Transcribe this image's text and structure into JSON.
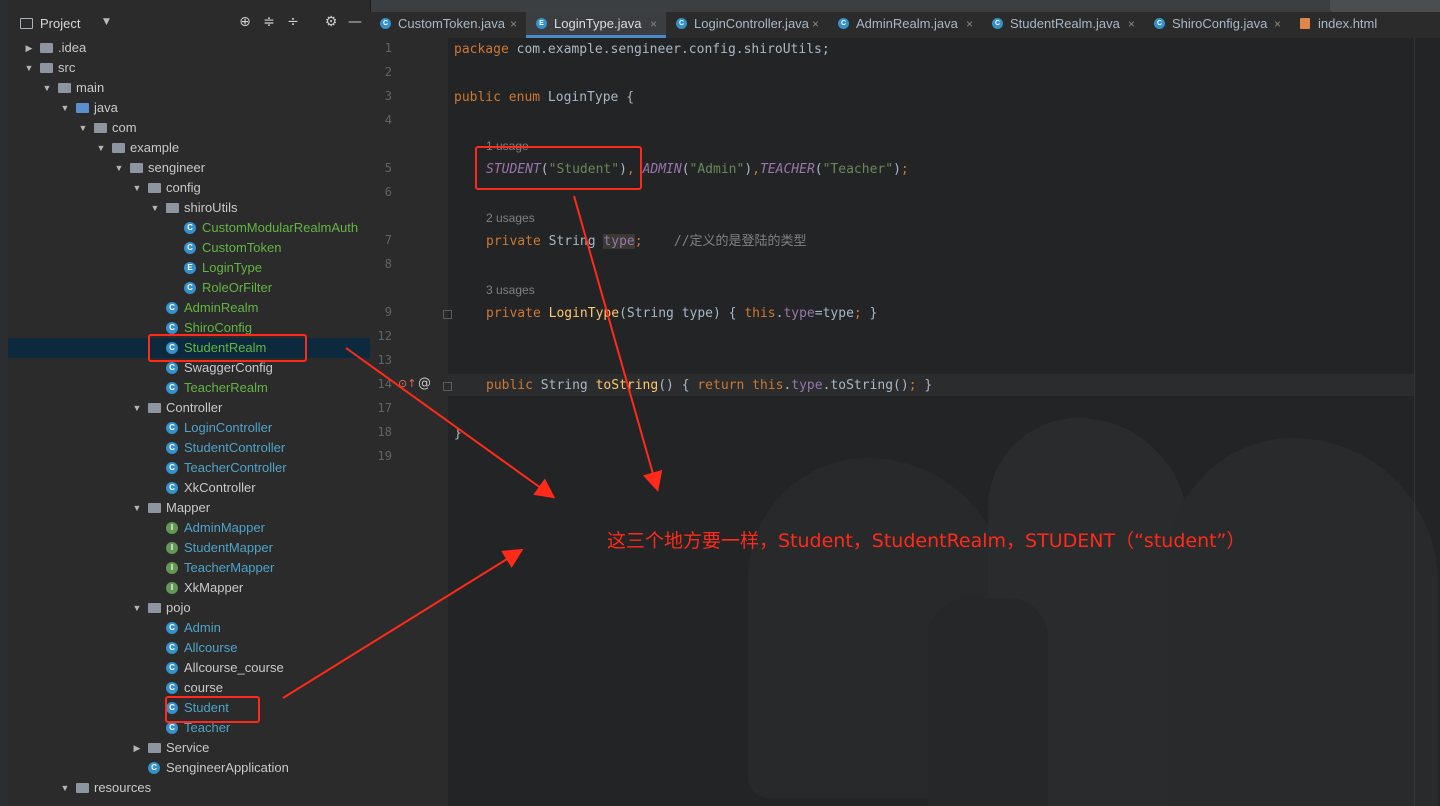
{
  "project_panel": {
    "title": "Project",
    "tree": [
      {
        "label": ".idea",
        "kind": "folder",
        "indent": 1,
        "arrow": "▶"
      },
      {
        "label": "src",
        "kind": "folder",
        "indent": 1,
        "arrow": "▼"
      },
      {
        "label": "main",
        "kind": "folder",
        "indent": 2,
        "arrow": "▼"
      },
      {
        "label": "java",
        "kind": "folder-blue",
        "indent": 3,
        "arrow": "▼"
      },
      {
        "label": "com",
        "kind": "folder",
        "indent": 4,
        "arrow": "▼"
      },
      {
        "label": "example",
        "kind": "folder",
        "indent": 5,
        "arrow": "▼"
      },
      {
        "label": "sengineer",
        "kind": "folder",
        "indent": 6,
        "arrow": "▼"
      },
      {
        "label": "config",
        "kind": "folder",
        "indent": 7,
        "arrow": "▼"
      },
      {
        "label": "shiroUtils",
        "kind": "folder",
        "indent": 8,
        "arrow": "▼"
      },
      {
        "label": "CustomModularRealmAuth",
        "kind": "class",
        "indent": 9,
        "color": "green"
      },
      {
        "label": "CustomToken",
        "kind": "class",
        "indent": 9,
        "color": "green"
      },
      {
        "label": "LoginType",
        "kind": "enum",
        "indent": 9,
        "color": "green"
      },
      {
        "label": "RoleOrFilter",
        "kind": "class",
        "indent": 9,
        "color": "green"
      },
      {
        "label": "AdminRealm",
        "kind": "class",
        "indent": 8,
        "color": "green"
      },
      {
        "label": "ShiroConfig",
        "kind": "class",
        "indent": 8,
        "color": "green"
      },
      {
        "label": "StudentRealm",
        "kind": "class",
        "indent": 8,
        "color": "green",
        "selected": true
      },
      {
        "label": "SwaggerConfig",
        "kind": "class",
        "indent": 8,
        "color": "plain"
      },
      {
        "label": "TeacherRealm",
        "kind": "class",
        "indent": 8,
        "color": "green"
      },
      {
        "label": "Controller",
        "kind": "folder",
        "indent": 7,
        "arrow": "▼"
      },
      {
        "label": "LoginController",
        "kind": "class",
        "indent": 8,
        "color": "teal"
      },
      {
        "label": "StudentController",
        "kind": "class",
        "indent": 8,
        "color": "teal"
      },
      {
        "label": "TeacherController",
        "kind": "class",
        "indent": 8,
        "color": "teal"
      },
      {
        "label": "XkController",
        "kind": "class",
        "indent": 8,
        "color": "plain"
      },
      {
        "label": "Mapper",
        "kind": "folder",
        "indent": 7,
        "arrow": "▼"
      },
      {
        "label": "AdminMapper",
        "kind": "interface",
        "indent": 8,
        "color": "teal"
      },
      {
        "label": "StudentMapper",
        "kind": "interface",
        "indent": 8,
        "color": "teal"
      },
      {
        "label": "TeacherMapper",
        "kind": "interface",
        "indent": 8,
        "color": "teal"
      },
      {
        "label": "XkMapper",
        "kind": "interface",
        "indent": 8,
        "color": "plain"
      },
      {
        "label": "pojo",
        "kind": "folder",
        "indent": 7,
        "arrow": "▼"
      },
      {
        "label": "Admin",
        "kind": "class",
        "indent": 8,
        "color": "teal"
      },
      {
        "label": "Allcourse",
        "kind": "class",
        "indent": 8,
        "color": "teal"
      },
      {
        "label": "Allcourse_course",
        "kind": "class",
        "indent": 8,
        "color": "plain"
      },
      {
        "label": "course",
        "kind": "class",
        "indent": 8,
        "color": "plain"
      },
      {
        "label": "Student",
        "kind": "class",
        "indent": 8,
        "color": "teal"
      },
      {
        "label": "Teacher",
        "kind": "class",
        "indent": 8,
        "color": "teal"
      },
      {
        "label": "Service",
        "kind": "folder",
        "indent": 7,
        "arrow": "▶"
      },
      {
        "label": "SengineerApplication",
        "kind": "app",
        "indent": 7,
        "color": "plain"
      },
      {
        "label": "resources",
        "kind": "folder",
        "indent": 3,
        "arrow": "▼"
      }
    ]
  },
  "tabs": [
    {
      "label": "CustomToken.java",
      "icon": "C",
      "active": false
    },
    {
      "label": "LoginType.java",
      "icon": "E",
      "active": true
    },
    {
      "label": "LoginController.java",
      "icon": "C",
      "active": false
    },
    {
      "label": "AdminRealm.java",
      "icon": "C",
      "active": false
    },
    {
      "label": "StudentRealm.java",
      "icon": "C",
      "active": false
    },
    {
      "label": "ShiroConfig.java",
      "icon": "C",
      "active": false
    },
    {
      "label": "index.html",
      "icon": "html",
      "active": false
    }
  ],
  "editor": {
    "line_numbers": [
      "1",
      "2",
      "3",
      "4",
      "5",
      "6",
      "7",
      "8",
      "9",
      "12",
      "13",
      "14",
      "17",
      "18",
      "19"
    ],
    "usage_hints": [
      "1 usage",
      "2 usages",
      "3 usages"
    ],
    "comment": "//定义的是登陆的类型",
    "package_name": "com.example.sengineer.config.shiroUtils",
    "enum_name": "LoginType",
    "constants": [
      {
        "name": "STUDENT",
        "value": "\"Student\""
      },
      {
        "name": "ADMIN",
        "value": "\"Admin\""
      },
      {
        "name": "TEACHER",
        "value": "\"Teacher\""
      }
    ]
  },
  "annotation": {
    "text": "这三个地方要一样，Student，StudentRealm，STUDENT（“student”）",
    "color": "#ff2a1a"
  },
  "colors": {
    "keyword": "#cc7832",
    "string": "#6a8759",
    "field": "#9876aa",
    "method": "#ffc66d",
    "accent": "#4a88c7"
  }
}
